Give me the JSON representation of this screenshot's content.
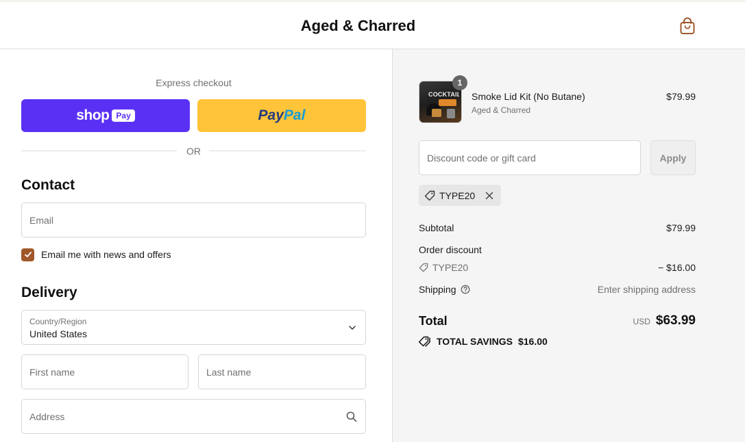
{
  "header": {
    "store_name": "Aged & Charred",
    "cart_icon": "shopping-bag-icon",
    "accent_color": "#a0572a"
  },
  "express": {
    "label": "Express checkout",
    "shop_pay": {
      "word": "shop",
      "badge": "Pay",
      "color": "#5a31f4"
    },
    "paypal": {
      "part1": "Pay",
      "part2": "Pal",
      "color": "#ffc439"
    },
    "divider_text": "OR"
  },
  "contact": {
    "title": "Contact",
    "email_placeholder": "Email",
    "newsletter_label": "Email me with news and offers",
    "newsletter_checked": true
  },
  "delivery": {
    "title": "Delivery",
    "country_label": "Country/Region",
    "country_value": "United States",
    "first_name_placeholder": "First name",
    "last_name_placeholder": "Last name",
    "address_placeholder": "Address"
  },
  "summary": {
    "product": {
      "image_text": "COCKTAIL",
      "quantity": "1",
      "name": "Smoke Lid Kit (No Butane)",
      "vendor": "Aged & Charred",
      "price": "$79.99"
    },
    "discount_placeholder": "Discount code or gift card",
    "apply_label": "Apply",
    "applied_code": "TYPE20",
    "subtotal_label": "Subtotal",
    "subtotal_value": "$79.99",
    "order_discount_label": "Order discount",
    "discount_code": "TYPE20",
    "discount_value": "− $16.00",
    "shipping_label": "Shipping",
    "shipping_value": "Enter shipping address",
    "total_label": "Total",
    "total_currency": "USD",
    "total_value": "$63.99",
    "savings_label": "TOTAL SAVINGS",
    "savings_value": "$16.00"
  }
}
